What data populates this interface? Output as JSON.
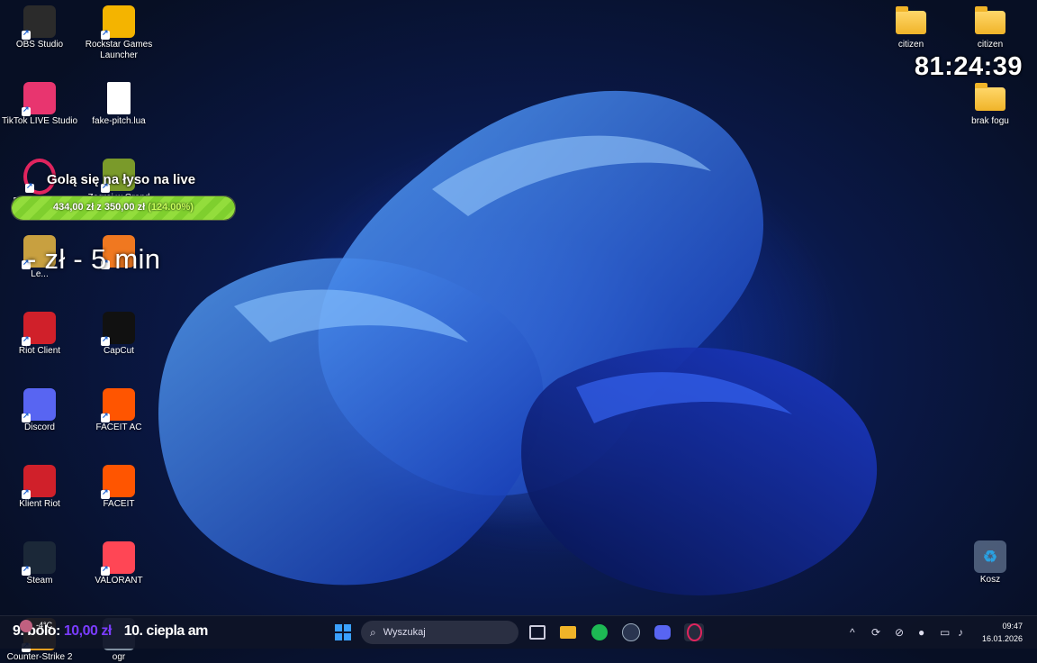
{
  "desktop": {
    "icons": [
      {
        "label": "OBS Studio",
        "icon": "obs-icon",
        "color": "#2b2b2b"
      },
      {
        "label": "Rockstar Games Launcher",
        "icon": "rockstar-icon",
        "color": "#f4b400"
      },
      {
        "label": "TikTok LIVE Studio",
        "icon": "tiktok-icon",
        "color": "#e8356f"
      },
      {
        "label": "fake-pitch.lua",
        "icon": "file-icon",
        "color": "#ffffff"
      },
      {
        "label": "Przeglądarka Opera GX",
        "icon": "opera-gx-icon",
        "color": "#e0245e"
      },
      {
        "label": "Zagraj w Grand Theft Auto V ...",
        "icon": "gta-v-icon",
        "color": "#7a9a2a"
      },
      {
        "label": "Le...",
        "icon": "league-icon",
        "color": "#c8a040"
      },
      {
        "label": "",
        "icon": "app-icon",
        "color": "#f07820"
      },
      {
        "label": "Riot Client",
        "icon": "riot-client-icon",
        "color": "#d0202a"
      },
      {
        "label": "CapCut",
        "icon": "capcut-icon",
        "color": "#111111"
      },
      {
        "label": "Discord",
        "icon": "discord-icon",
        "color": "#5865f2"
      },
      {
        "label": "FACEIT AC",
        "icon": "faceit-ac-icon",
        "color": "#ff5500"
      },
      {
        "label": "Klient Riot",
        "icon": "riot-client-icon",
        "color": "#d0202a"
      },
      {
        "label": "FACEIT",
        "icon": "faceit-icon",
        "color": "#ff5500"
      },
      {
        "label": "Steam",
        "icon": "steam-icon",
        "color": "#1b2838"
      },
      {
        "label": "VALORANT",
        "icon": "valorant-icon",
        "color": "#ff4655"
      },
      {
        "label": "Counter-Strike 2",
        "icon": "cs2-icon",
        "color": "#e8a020"
      },
      {
        "label": "ogr",
        "icon": "image-file-icon",
        "color": "#8090a0"
      }
    ],
    "right_icons": [
      {
        "label": "citizen",
        "icon": "folder-icon"
      },
      {
        "label": "citizen",
        "icon": "folder-icon"
      },
      {
        "label": "brak fogu",
        "icon": "folder-icon"
      },
      {
        "label": "Kosz",
        "icon": "recycle-bin-icon"
      }
    ]
  },
  "overlay": {
    "timer": "81:24:39",
    "goal_title": "Golą się na łyso na live",
    "goal_amount": "434,00 zł",
    "goal_sep": "z",
    "goal_target": "350,00 zł",
    "goal_percent": "(124.00%)",
    "goal_fraction": 1.0,
    "donation_line": "- zł - 5 min"
  },
  "taskbar": {
    "weather_temp": "-4°C",
    "ticker": [
      {
        "prefix": "9. bolo:",
        "amount": "10,00 zł"
      },
      {
        "prefix": "10. ciepla am",
        "amount": ""
      }
    ],
    "search_placeholder": "Wyszukaj",
    "time": "09:47",
    "date": "16.01.2026",
    "colors": {
      "start": "#3aa0ff",
      "explorer": "#f0b429",
      "spotify": "#1db954",
      "discord": "#5865f2",
      "opera": "#e0245e"
    }
  }
}
